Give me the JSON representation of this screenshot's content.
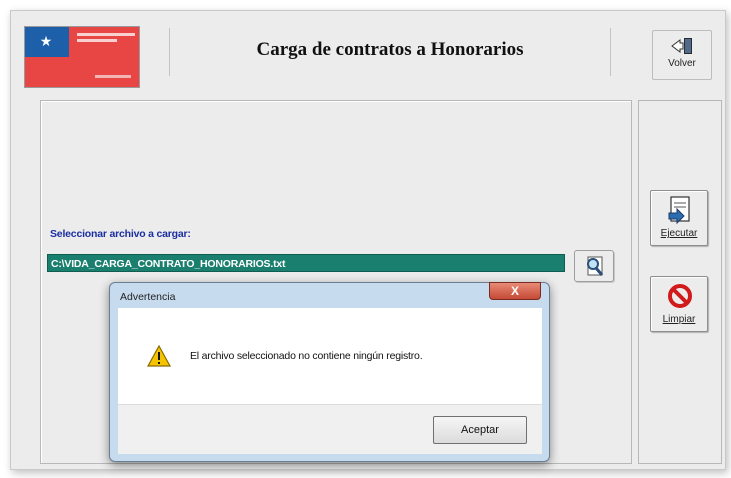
{
  "window": {
    "title": "Carga de contratos a Honorarios"
  },
  "toolbar": {
    "volver_label": "Volver"
  },
  "form": {
    "field_label": "Seleccionar archivo a cargar:",
    "file_path": "C:\\VIDA_CARGA_CONTRATO_HONORARIOS.txt"
  },
  "side_buttons": {
    "ejecutar_label": "Ejecutar",
    "limpiar_label": "Limpiar"
  },
  "dialog": {
    "title": "Advertencia",
    "close_label": "X",
    "message": "El archivo seleccionado no contiene ningún registro.",
    "accept_label": "Aceptar"
  },
  "colors": {
    "path_field_bg": "#1a7f6e",
    "label_blue": "#1a2ea0",
    "close_red": "#c44a36"
  },
  "icons": {
    "volver": "door-exit-icon",
    "browse": "magnifier-icon",
    "ejecutar": "run-document-icon",
    "limpiar": "no-entry-icon",
    "warning": "warning-triangle-icon"
  }
}
